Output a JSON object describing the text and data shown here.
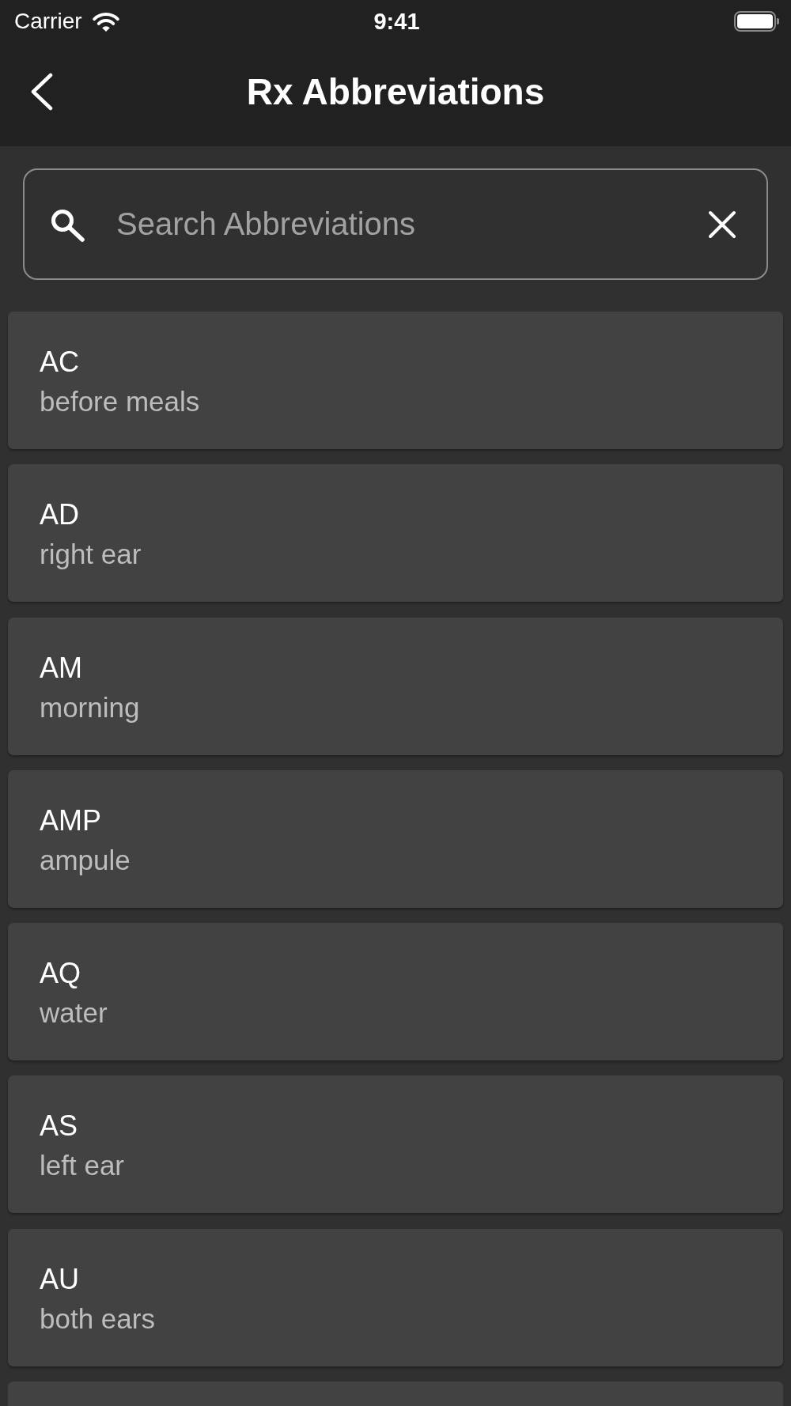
{
  "status_bar": {
    "carrier": "Carrier",
    "time": "9:41"
  },
  "nav_bar": {
    "title": "Rx Abbreviations"
  },
  "search": {
    "placeholder": "Search Abbreviations"
  },
  "abbreviations": [
    {
      "kind": "entry",
      "abbreviation": "AC",
      "meaning": "before meals"
    },
    {
      "kind": "entry",
      "abbreviation": "AD",
      "meaning": "right ear"
    },
    {
      "kind": "entry",
      "abbreviation": "AM",
      "meaning": "morning"
    },
    {
      "kind": "entry",
      "abbreviation": "AMP",
      "meaning": "ampule"
    },
    {
      "kind": "entry",
      "abbreviation": "AQ",
      "meaning": "water"
    },
    {
      "kind": "entry",
      "abbreviation": "AS",
      "meaning": "left ear"
    },
    {
      "kind": "entry",
      "abbreviation": "AU",
      "meaning": "both ears"
    },
    {
      "kind": "partial"
    }
  ]
}
